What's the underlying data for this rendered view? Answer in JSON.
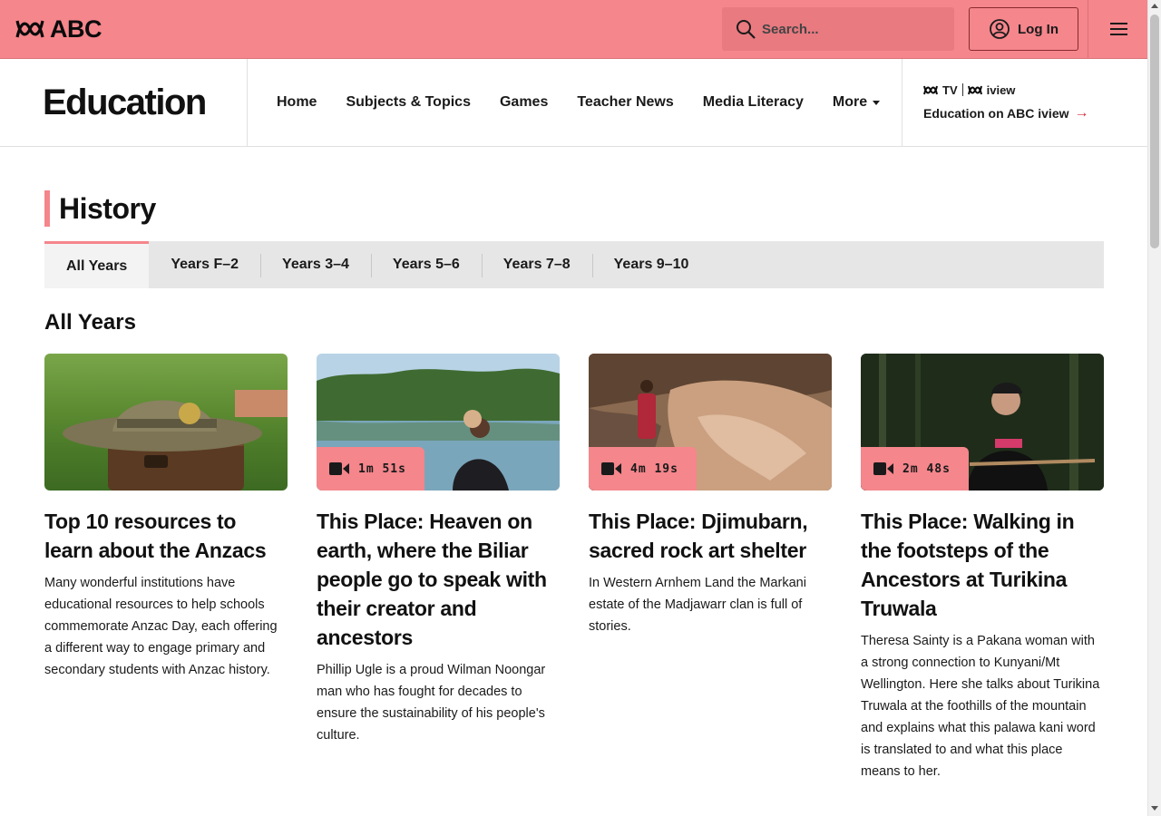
{
  "header": {
    "logo_text": "ABC",
    "search_placeholder": "Search...",
    "login_label": "Log In",
    "brand_color": "#f4868c"
  },
  "section": {
    "title": "Education",
    "nav": [
      {
        "label": "Home"
      },
      {
        "label": "Subjects & Topics"
      },
      {
        "label": "Games"
      },
      {
        "label": "Teacher News"
      },
      {
        "label": "Media Literacy"
      },
      {
        "label": "More"
      }
    ],
    "iview": {
      "logo_tv": "TV",
      "logo_iview": "iview",
      "link_label": "Education on ABC iview",
      "arrow": "→"
    }
  },
  "page": {
    "heading": "History",
    "tabs": [
      {
        "label": "All Years",
        "active": true
      },
      {
        "label": "Years F–2"
      },
      {
        "label": "Years 3–4"
      },
      {
        "label": "Years 5–6"
      },
      {
        "label": "Years 7–8"
      },
      {
        "label": "Years 9–10"
      }
    ],
    "sub_heading": "All Years"
  },
  "cards": [
    {
      "title": "Top 10 resources to learn about the Anzacs",
      "description": "Many wonderful institutions have educational resources to help schools commemorate Anzac Day, each offering a different way to engage primary and secondary students with Anzac history.",
      "duration": "",
      "image": "slouch-hat-on-suitcase"
    },
    {
      "title": "This Place: Heaven on earth, where the Biliar people go to speak with their creator and ancestors",
      "description": "Phillip Ugle is a proud Wilman Noongar man who has fought for decades to ensure the sustainability of his people's culture.",
      "duration": "1m 51s",
      "image": "lake-with-people"
    },
    {
      "title": "This Place: Djimubarn, sacred rock art shelter",
      "description": "In Western Arnhem Land the Markani estate of the Madjawarr clan is full of stories.",
      "duration": "4m 19s",
      "image": "rock-shelter"
    },
    {
      "title": "This Place: Walking in the footsteps of the Ancestors at Turikina Truwala",
      "description": "Theresa Sainty is a Pakana woman with a strong connection to Kunyani/Mt Wellington. Here she talks about Turikina Truwala at the foothills of the mountain and explains what this palawa kani word is translated to and what this place means to her.",
      "duration": "2m 48s",
      "image": "woman-in-forest"
    }
  ]
}
